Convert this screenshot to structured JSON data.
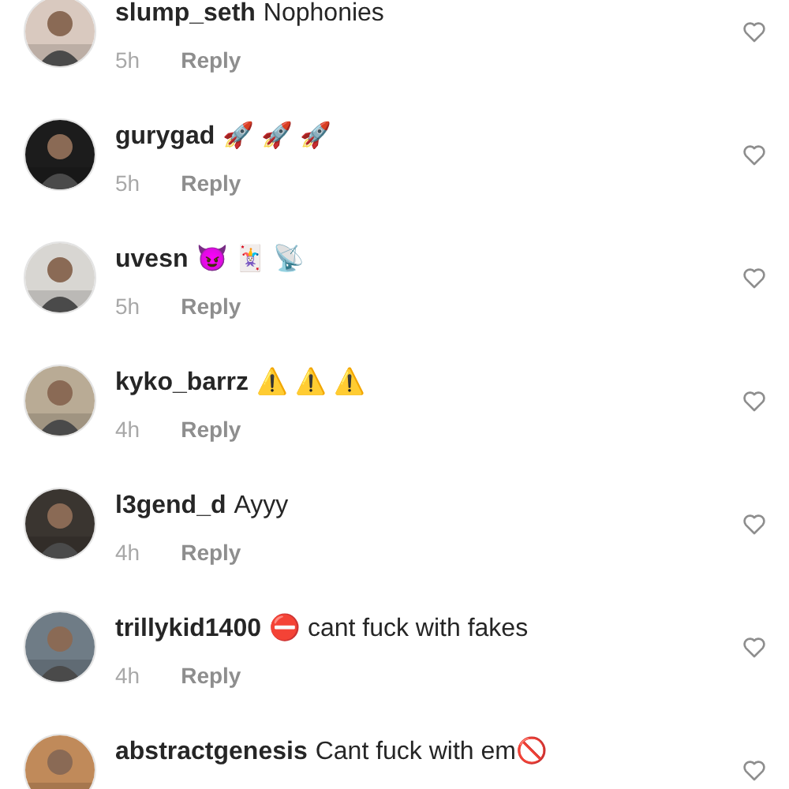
{
  "comments": [
    {
      "username": "slump_seth",
      "text": "Nophonies",
      "time": "5h",
      "reply": "Reply"
    },
    {
      "username": "gurygad",
      "text": "🚀 🚀 🚀",
      "time": "5h",
      "reply": "Reply"
    },
    {
      "username": "uvesn",
      "text": "😈 🃏 📡",
      "time": "5h",
      "reply": "Reply"
    },
    {
      "username": "kyko_barrz",
      "text": "⚠️ ⚠️ ⚠️",
      "time": "4h",
      "reply": "Reply"
    },
    {
      "username": "l3gend_d",
      "text": "Ayyy",
      "time": "4h",
      "reply": "Reply"
    },
    {
      "username": "trillykid1400",
      "text": "⛔ cant fuck with fakes",
      "time": "4h",
      "reply": "Reply"
    },
    {
      "username": "abstractgenesis",
      "text": "Cant fuck with em🚫"
    }
  ]
}
